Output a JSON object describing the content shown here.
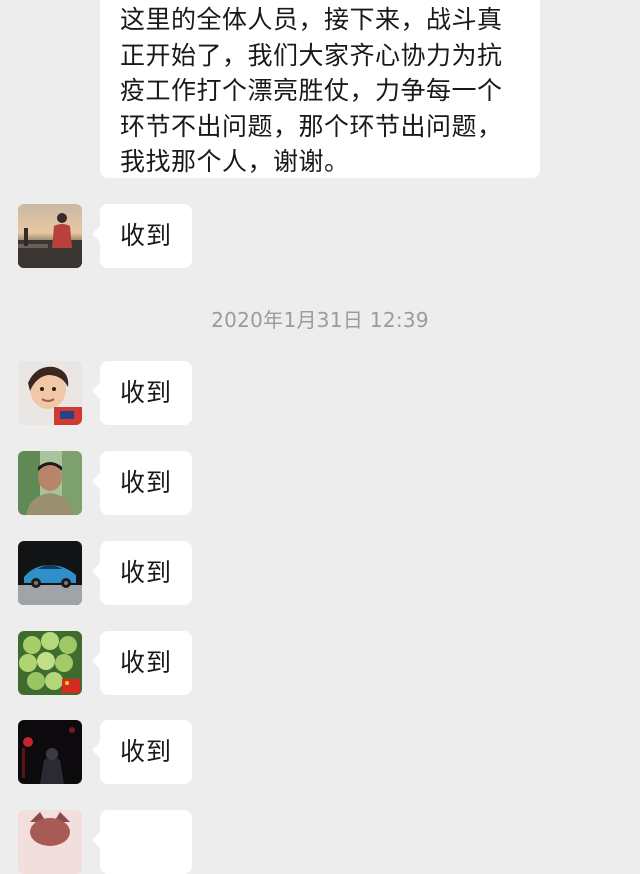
{
  "top_message": {
    "lines": [
      "这里的全体人员，接下来，战斗真",
      "正开始了，我们大家齐心协力为抗",
      "疫工作打个漂亮胜仗，力争每一个",
      "环节不出问题，那个环节出问题，",
      "我找那个人，谢谢。"
    ]
  },
  "timestamp": "2020年1月31日 12:39",
  "messages": [
    {
      "text": "收到",
      "avatar": "sunset-person-avatar"
    },
    {
      "text": "收到",
      "avatar": "child-avatar"
    },
    {
      "text": "收到",
      "avatar": "man-portrait-avatar"
    },
    {
      "text": "收到",
      "avatar": "sports-car-avatar"
    },
    {
      "text": "收到",
      "avatar": "green-grapes-avatar"
    },
    {
      "text": "收到",
      "avatar": "dark-night-avatar"
    },
    {
      "text": "",
      "avatar": "cat-avatar"
    }
  ],
  "colors": {
    "background": "#ededed",
    "bubble": "#ffffff",
    "text": "#191919",
    "timestamp": "#9b9b9b"
  }
}
